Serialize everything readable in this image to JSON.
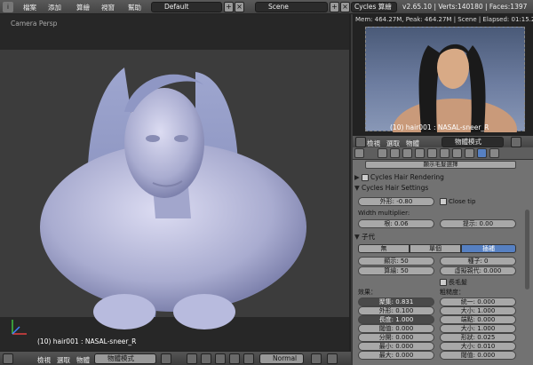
{
  "topbar": {
    "menus": [
      "檔案",
      "添加",
      "算繪",
      "視窗",
      "幫助"
    ],
    "layout": "Default",
    "scene": "Scene",
    "engine": "Cycles 算繪",
    "stats": "v2.65.10 | Verts:140180 | Faces:1397"
  },
  "viewport": {
    "camera_label": "Camera Persp",
    "object_name": "(10) hair001 : NASAL-sneer_R"
  },
  "render": {
    "info": "Mem: 464.27M, Peak: 464.27M | Scene | Elapsed: 01:15.23 | Rend",
    "object_name": "(10) hair001 : NASAL-sneer_R",
    "header": {
      "menus": [
        "檢視",
        "選取",
        "物體"
      ],
      "mode": "物體模式"
    }
  },
  "bottombar": {
    "menus": [
      "檢視",
      "選取",
      "物體"
    ],
    "mode": "物體模式",
    "shading": "Normal"
  },
  "properties": {
    "top_button": "顯示毛髮選擇",
    "panel_hair_rendering": "Cycles Hair Rendering",
    "panel_hair_settings": "Cycles Hair Settings",
    "shape_label": "外形: -0.80",
    "close_tip": "Close tip",
    "width_multiplier": "Width multiplier:",
    "root_label": "根: 0.06",
    "tip_label": "提示: 0.00",
    "children_panel": "子代",
    "child_modes": [
      "無",
      "單個",
      "插補"
    ],
    "display_label": "顯示: 50",
    "seed_label": "種子: 0",
    "render_label": "算繪: 50",
    "virtual_parents": "虛擬親代: 0.000",
    "long_hair": "長毛髮",
    "effects_label": "效果：",
    "roughness_label": "粗糙度：",
    "left_fields": [
      "聚集: 0.831",
      "外形: 0.100",
      "長度: 1.000",
      "閾值: 0.000",
      "分開: 0.000",
      "最小: 0.000",
      "最大: 0.000"
    ],
    "right_fields": [
      "統一: 0.000",
      "大小: 1.000",
      "端點: 0.000",
      "大小: 1.000",
      "形狀: 0.025",
      "大小: 0.010",
      "閾值: 0.000"
    ]
  }
}
